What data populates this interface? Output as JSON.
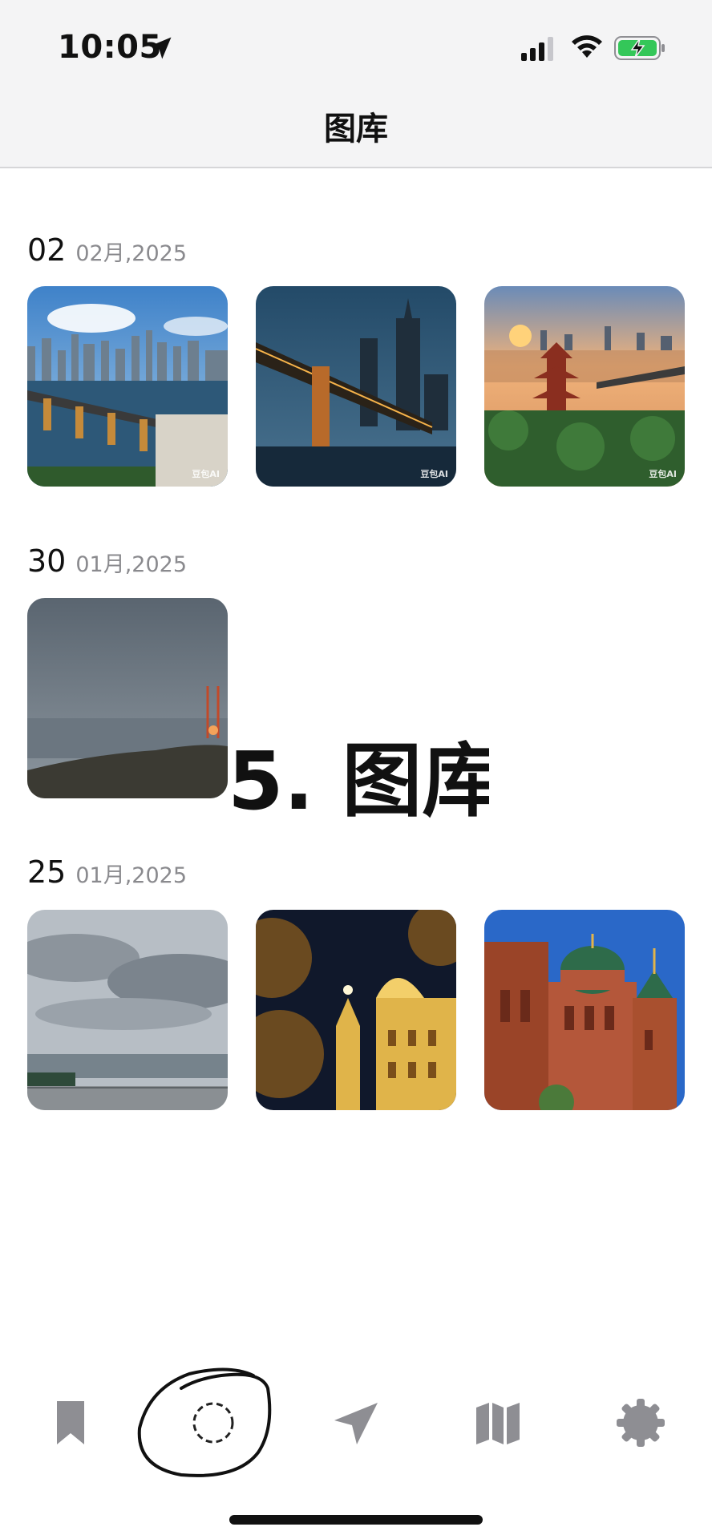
{
  "status_bar": {
    "time": "10:05",
    "battery_color": "#34c759",
    "battery_state": "charging"
  },
  "header": {
    "title": "图库"
  },
  "sections": [
    {
      "day": "02",
      "month_year": "02月,2025",
      "photos": [
        {
          "subject": "city skyline with bridge, daytime",
          "watermark": "豆包AI"
        },
        {
          "subject": "bridge and skyscrapers at dusk",
          "watermark": "豆包AI"
        },
        {
          "subject": "pagoda tower at sunset over city",
          "watermark": "豆包AI"
        }
      ]
    },
    {
      "day": "30",
      "month_year": "01月,2025",
      "photos": [
        {
          "subject": "foggy coastline with bridge tower",
          "watermark": ""
        }
      ]
    },
    {
      "day": "25",
      "month_year": "01月,2025",
      "photos": [
        {
          "subject": "cloudy sky over seafront",
          "watermark": ""
        },
        {
          "subject": "illuminated building at night with moon",
          "watermark": ""
        },
        {
          "subject": "red brick cathedral with green dome",
          "watermark": ""
        }
      ]
    }
  ],
  "overlay_caption": "5. 图库",
  "tab_bar": {
    "active_index": 1,
    "tabs": [
      {
        "icon": "bookmark-icon"
      },
      {
        "icon": "camera-shutter-icon"
      },
      {
        "icon": "navigation-arrow-icon"
      },
      {
        "icon": "map-icon"
      },
      {
        "icon": "settings-gear-icon"
      }
    ],
    "icon_color": "#8e8e93"
  }
}
